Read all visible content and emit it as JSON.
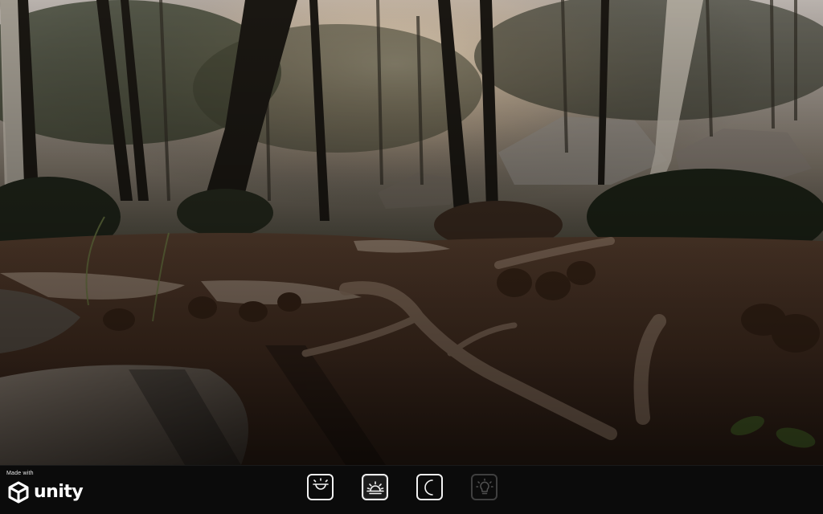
{
  "branding": {
    "made_with_label": "Made with",
    "engine_name": "unity"
  },
  "scene": {
    "description_icon": "forest-scene"
  },
  "time_of_day_controls": [
    {
      "id": "morning",
      "icon": "sunrise-icon",
      "state": "normal"
    },
    {
      "id": "day",
      "icon": "sunset-icon",
      "state": "selected"
    },
    {
      "id": "night",
      "icon": "moon-icon",
      "state": "normal"
    },
    {
      "id": "light",
      "icon": "lightbulb-icon",
      "state": "disabled"
    }
  ],
  "colors": {
    "bar_background": "#0b0b0b",
    "button_border": "#f2f2f2",
    "button_disabled": "#6a6a6a"
  }
}
